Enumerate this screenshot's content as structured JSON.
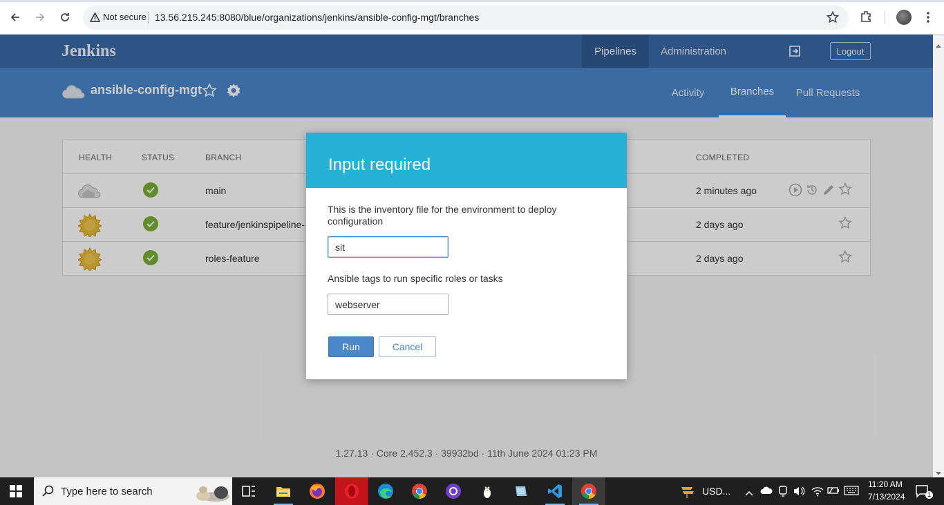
{
  "browser": {
    "security_label": "Not secure",
    "url": "13.56.215.245:8080/blue/organizations/jenkins/ansible-config-mgt/branches"
  },
  "header": {
    "logo": "Jenkins",
    "nav": {
      "pipelines": "Pipelines",
      "administration": "Administration"
    },
    "logout": "Logout"
  },
  "pipeline": {
    "name": "ansible-config-mgt",
    "tabs": {
      "activity": "Activity",
      "branches": "Branches",
      "pull_requests": "Pull Requests"
    }
  },
  "table": {
    "headers": {
      "health": "HEALTH",
      "status": "STATUS",
      "branch": "BRANCH",
      "completed": "COMPLETED"
    },
    "rows": [
      {
        "branch": "main",
        "completed": "2 minutes ago",
        "health": "cloudy",
        "status": "success"
      },
      {
        "branch": "feature/jenkinspipeline-",
        "completed": "2 days ago",
        "health": "sunny",
        "status": "success"
      },
      {
        "branch": "roles-feature",
        "completed": "2 days ago",
        "health": "sunny",
        "status": "success"
      }
    ]
  },
  "footer": "1.27.13 · Core 2.452.3 · 39932bd · 11th June 2024 01:23 PM",
  "modal": {
    "title": "Input required",
    "fields": [
      {
        "label": "This is the inventory file for the environment to deploy configuration",
        "value": "sit"
      },
      {
        "label": "Ansible tags to run specific roles or tasks",
        "value": "webserver"
      }
    ],
    "run": "Run",
    "cancel": "Cancel"
  },
  "taskbar": {
    "search_placeholder": "Type here to search",
    "weather": "USD...",
    "time": "11:20 AM",
    "date": "7/13/2024",
    "notifications": "1"
  },
  "colors": {
    "topbar": "#3a6aa8",
    "subbar": "#4a86c8",
    "modal_header": "#27b1d6",
    "success": "#78b037"
  }
}
